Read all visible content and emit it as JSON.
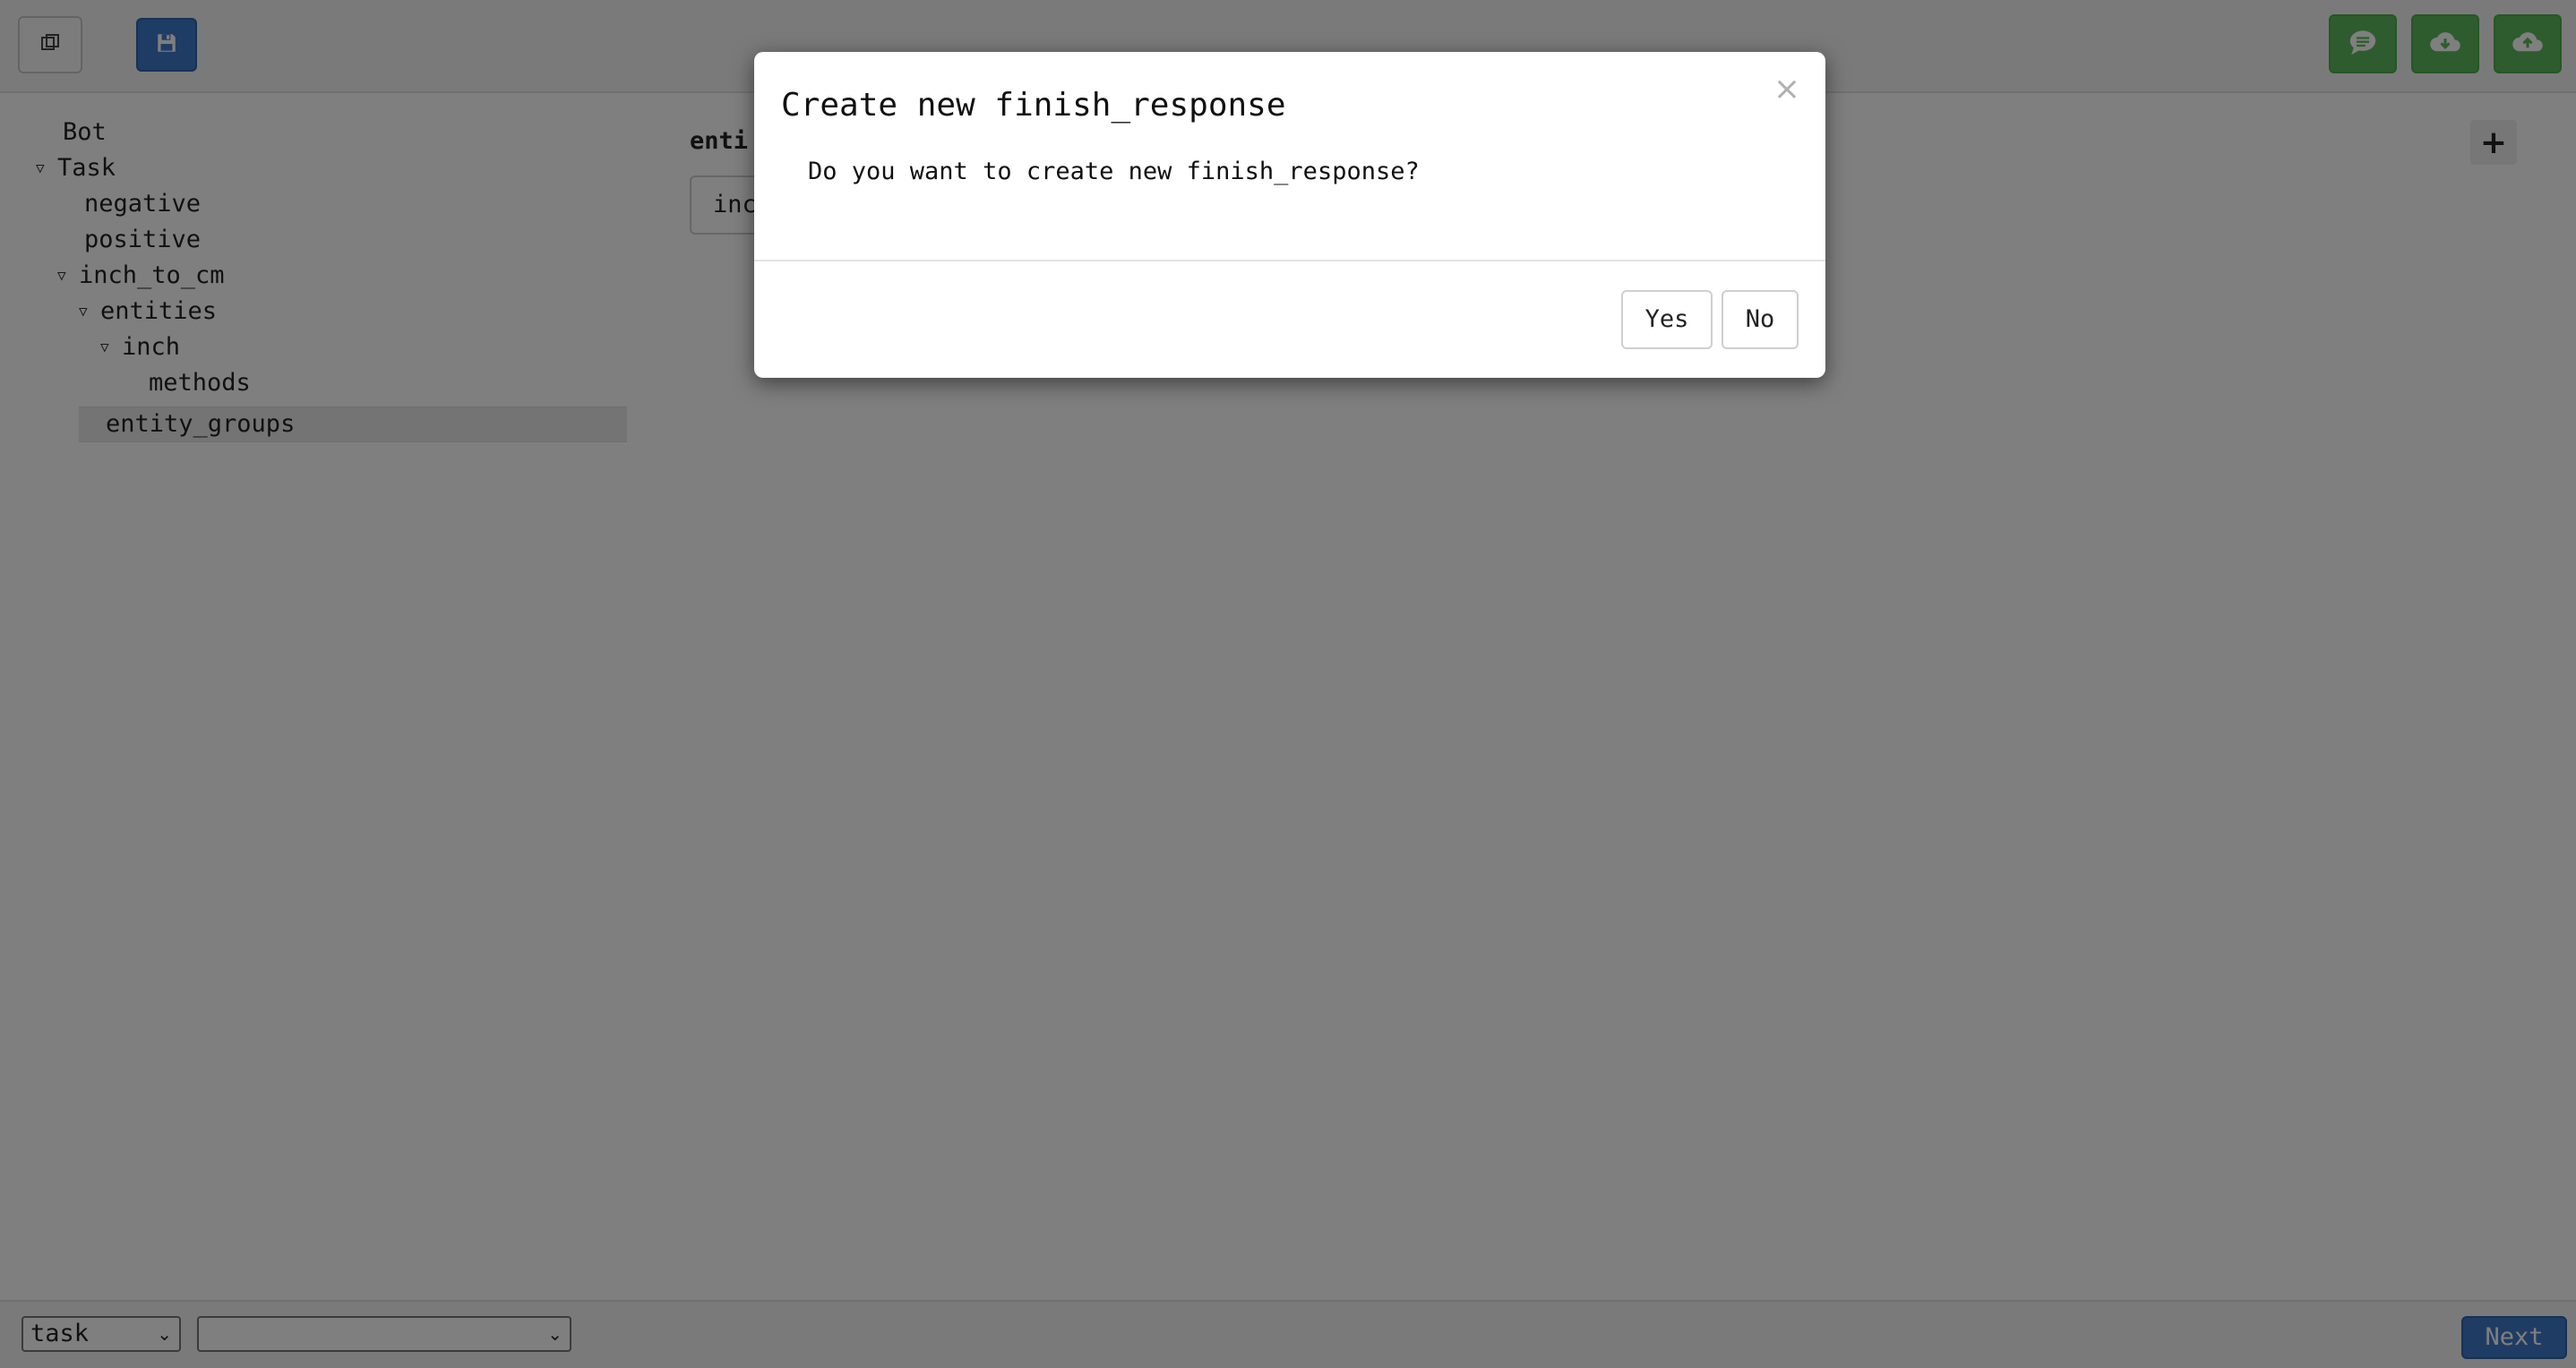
{
  "toolbar": {
    "left_buttons": [
      {
        "icon": "copy-icon"
      },
      {
        "icon": "save-icon"
      }
    ],
    "right_buttons": [
      {
        "icon": "chat-icon",
        "color": "#5cb85c"
      },
      {
        "icon": "cloud-download-icon",
        "color": "#5cb85c"
      },
      {
        "icon": "cloud-upload-icon",
        "color": "#5cb85c"
      }
    ],
    "save_color": "#3f78c8"
  },
  "tree": {
    "items": [
      {
        "label": "Bot",
        "expanded": null
      },
      {
        "label": "Task",
        "expanded": true
      },
      {
        "label": "negative",
        "expanded": null
      },
      {
        "label": "positive",
        "expanded": null
      },
      {
        "label": "inch_to_cm",
        "expanded": true
      },
      {
        "label": "entities",
        "expanded": true
      },
      {
        "label": "inch",
        "expanded": true
      },
      {
        "label": "methods",
        "expanded": null
      },
      {
        "label": "entity_groups",
        "expanded": null,
        "selected": true
      }
    ]
  },
  "main": {
    "label_visible": "enti",
    "field_value_visible": "inc",
    "add_icon": "plus-icon"
  },
  "bottom": {
    "type_select": {
      "value": "task"
    },
    "second_select": {
      "value": ""
    },
    "next_label": "Next"
  },
  "modal": {
    "title": "Create new finish_response",
    "close_symbol": "×",
    "message": "Do you want to create new finish_response?",
    "yes_label": "Yes",
    "no_label": "No"
  }
}
